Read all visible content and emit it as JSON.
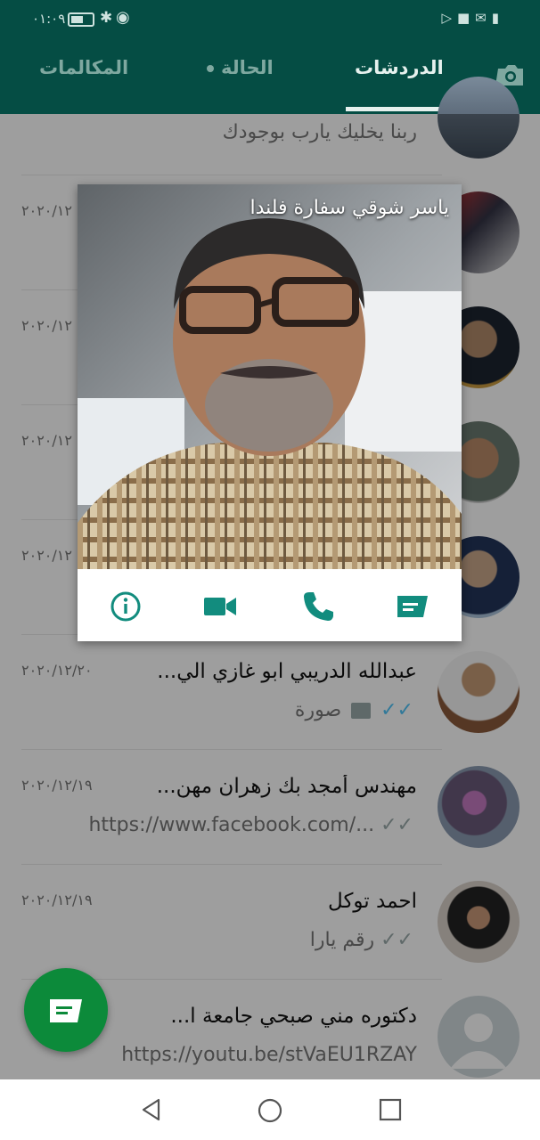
{
  "status_bar": {
    "time": "٠١:٠٩"
  },
  "tabs": {
    "chats": "الدردشات",
    "status": "الحالة",
    "calls": "المكالمات"
  },
  "chats": [
    {
      "name": "",
      "message": "ربنا يخليك يارب بوجودك",
      "date": ""
    },
    {
      "name": "",
      "message": "",
      "date": "٢٠٢٠/١٢"
    },
    {
      "name": "",
      "message": "",
      "date": "٢٠٢٠/١٢"
    },
    {
      "name": "",
      "message": "",
      "date": "٢٠٢٠/١٢"
    },
    {
      "name": "",
      "message": "",
      "date": "٢٠٢٠/١٢"
    },
    {
      "name": "عبدالله الدريبي ابو غازي الي...",
      "message": "صورة",
      "date": "٢٠٢٠/١٢/٢٠"
    },
    {
      "name": "مهندس أمجد بك زهران مهن...",
      "message": "https://www.facebook.com/...",
      "date": "٢٠٢٠/١٢/١٩"
    },
    {
      "name": "احمد توكل",
      "message": "رقم يارا",
      "date": "٢٠٢٠/١٢/١٩"
    },
    {
      "name": "دكتوره مني صبحي جامعة ا...",
      "message": "https://youtu.be/stVaEU1RZAY",
      "date": ""
    }
  ],
  "popup": {
    "contact_name": "ياسر شوقي سفارة فلندا"
  },
  "colors": {
    "header": "#054d44",
    "accent": "#128c7e",
    "fab": "#0c8a3a",
    "read_ticks": "#4fc3f7"
  }
}
